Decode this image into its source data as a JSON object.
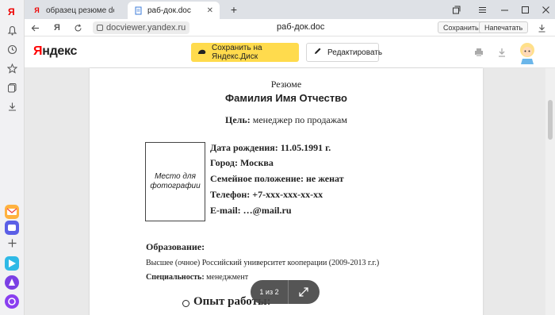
{
  "tabs": [
    {
      "title": "образец резюме doc — Я",
      "icon": "yandex-y-icon"
    },
    {
      "title": "раб-док.doc",
      "icon": "docviewer-icon"
    }
  ],
  "addressbar": {
    "url": "docviewer.yandex.ru",
    "page_title": "раб-док.doc",
    "save_label": "Сохранить",
    "print_label": "Напечатать"
  },
  "header": {
    "logo": "Яндекс",
    "save_to_disk": "Сохранить на Яндекс.Диск",
    "edit": "Редактировать"
  },
  "document": {
    "title": "Резюме",
    "name": "Фамилия Имя Отчество",
    "goal_label": "Цель:",
    "goal_value": "менеджер по продажам",
    "photo_placeholder": "Место для фотографии",
    "info": [
      "Дата рождения: 11.05.1991 г.",
      "Город: Москва",
      "Семейное положение: не женат",
      "Телефон: +7-xxx-xxx-xx-xx",
      "E-mail: …@mail.ru"
    ],
    "education_heading": "Образование:",
    "education_text": "Высшее (очное) Российский университет кооперации (2009-2013 г.г.)",
    "specialty_label": "Специальность:",
    "specialty_value": "менеджмент",
    "work_heading": "Опыт работы:"
  },
  "pager": {
    "page": "1 из 2"
  },
  "colors": {
    "accent": "#ffdb4d",
    "logo_red": "#ff0000"
  }
}
